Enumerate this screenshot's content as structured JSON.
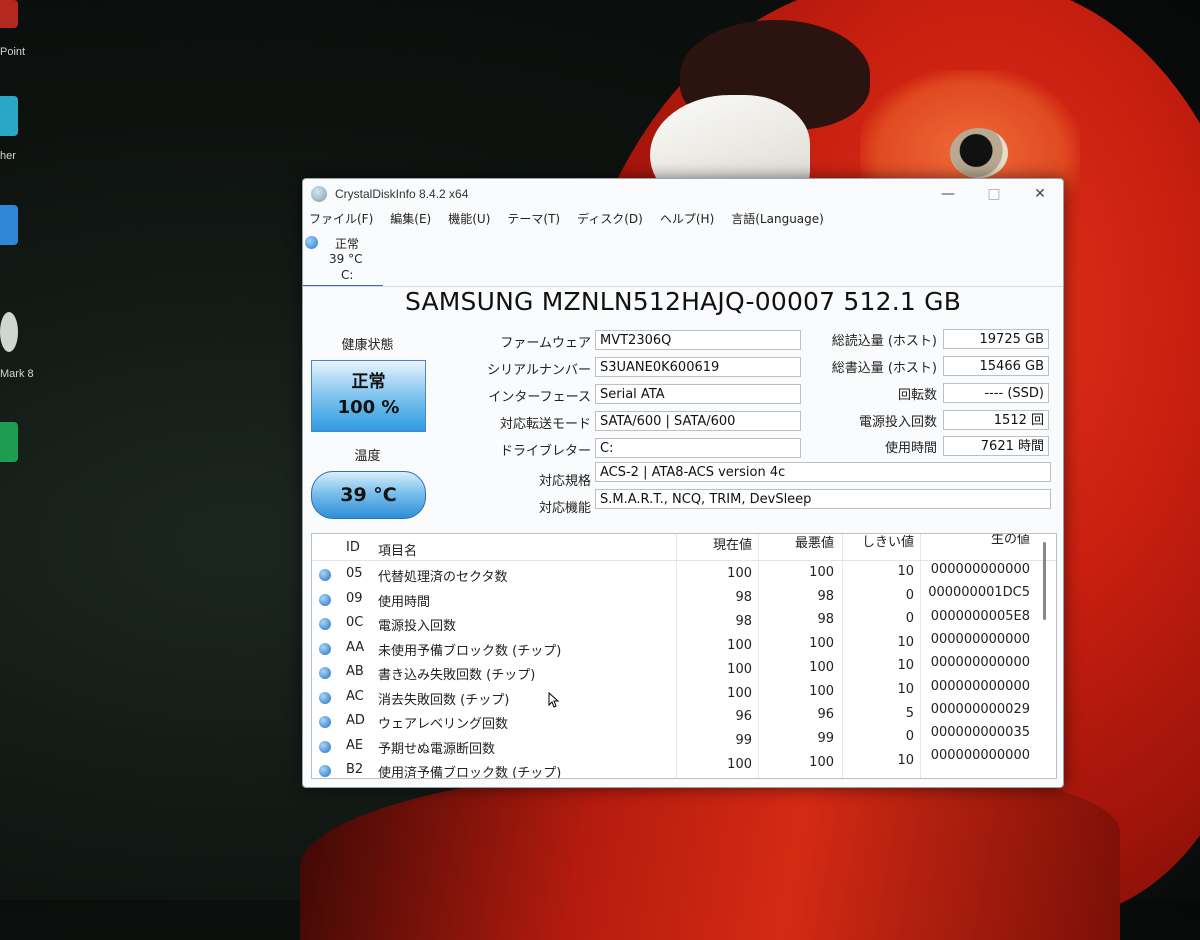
{
  "desktop": {
    "labels": [
      "Point",
      "her",
      "Mark 8"
    ]
  },
  "window": {
    "title": "CrystalDiskInfo 8.4.2 x64",
    "controls": {
      "minimize": "—",
      "maximize": "□",
      "close": "✕"
    },
    "menu": [
      "ファイル(F)",
      "編集(E)",
      "機能(U)",
      "テーマ(T)",
      "ディスク(D)",
      "ヘルプ(H)",
      "言語(Language)"
    ],
    "disk_tab": {
      "status": "正常",
      "temp": "39 °C",
      "drive": "C:"
    },
    "model": "SAMSUNG MZNLN512HAJQ-00007 512.1 GB",
    "health": {
      "label": "健康状態",
      "status": "正常",
      "percent": "100 %"
    },
    "temperature": {
      "label": "温度",
      "value": "39 °C"
    },
    "info": {
      "firmware": {
        "label": "ファームウェア",
        "value": "MVT2306Q"
      },
      "serial": {
        "label": "シリアルナンバー",
        "value": "S3UANE0K600619"
      },
      "interface": {
        "label": "インターフェース",
        "value": "Serial ATA"
      },
      "transfer": {
        "label": "対応転送モード",
        "value": "SATA/600 | SATA/600"
      },
      "drive_letter": {
        "label": "ドライブレター",
        "value": "C:"
      },
      "standard": {
        "label": "対応規格",
        "value": "ACS-2 | ATA8-ACS version 4c"
      },
      "features": {
        "label": "対応機能",
        "value": "S.M.A.R.T., NCQ, TRIM, DevSleep"
      }
    },
    "stats": {
      "reads": {
        "label": "総読込量 (ホスト)",
        "value": "19725 GB"
      },
      "writes": {
        "label": "総書込量 (ホスト)",
        "value": "15466 GB"
      },
      "rotation": {
        "label": "回転数",
        "value": "---- (SSD)"
      },
      "power_count": {
        "label": "電源投入回数",
        "value": "1512 回"
      },
      "power_hours": {
        "label": "使用時間",
        "value": "7621 時間"
      }
    },
    "smart": {
      "headers": {
        "id": "ID",
        "name": "項目名",
        "current": "現在値",
        "worst": "最悪値",
        "threshold": "しきい値",
        "raw": "生の値"
      },
      "rows": [
        {
          "id": "05",
          "name": "代替処理済のセクタ数",
          "current": "100",
          "worst": "100",
          "threshold": "10",
          "raw": "000000000000"
        },
        {
          "id": "09",
          "name": "使用時間",
          "current": "98",
          "worst": "98",
          "threshold": "0",
          "raw": "000000001DC5"
        },
        {
          "id": "0C",
          "name": "電源投入回数",
          "current": "98",
          "worst": "98",
          "threshold": "0",
          "raw": "0000000005E8"
        },
        {
          "id": "AA",
          "name": "未使用予備ブロック数 (チップ)",
          "current": "100",
          "worst": "100",
          "threshold": "10",
          "raw": "000000000000"
        },
        {
          "id": "AB",
          "name": "書き込み失敗回数 (チップ)",
          "current": "100",
          "worst": "100",
          "threshold": "10",
          "raw": "000000000000"
        },
        {
          "id": "AC",
          "name": "消去失敗回数 (チップ)",
          "current": "100",
          "worst": "100",
          "threshold": "10",
          "raw": "000000000000"
        },
        {
          "id": "AD",
          "name": "ウェアレベリング回数",
          "current": "96",
          "worst": "96",
          "threshold": "5",
          "raw": "000000000029"
        },
        {
          "id": "AE",
          "name": "予期せぬ電源断回数",
          "current": "99",
          "worst": "99",
          "threshold": "0",
          "raw": "000000000035"
        },
        {
          "id": "B2",
          "name": "使用済予備ブロック数 (チップ)",
          "current": "100",
          "worst": "100",
          "threshold": "10",
          "raw": "000000000000"
        }
      ]
    }
  }
}
